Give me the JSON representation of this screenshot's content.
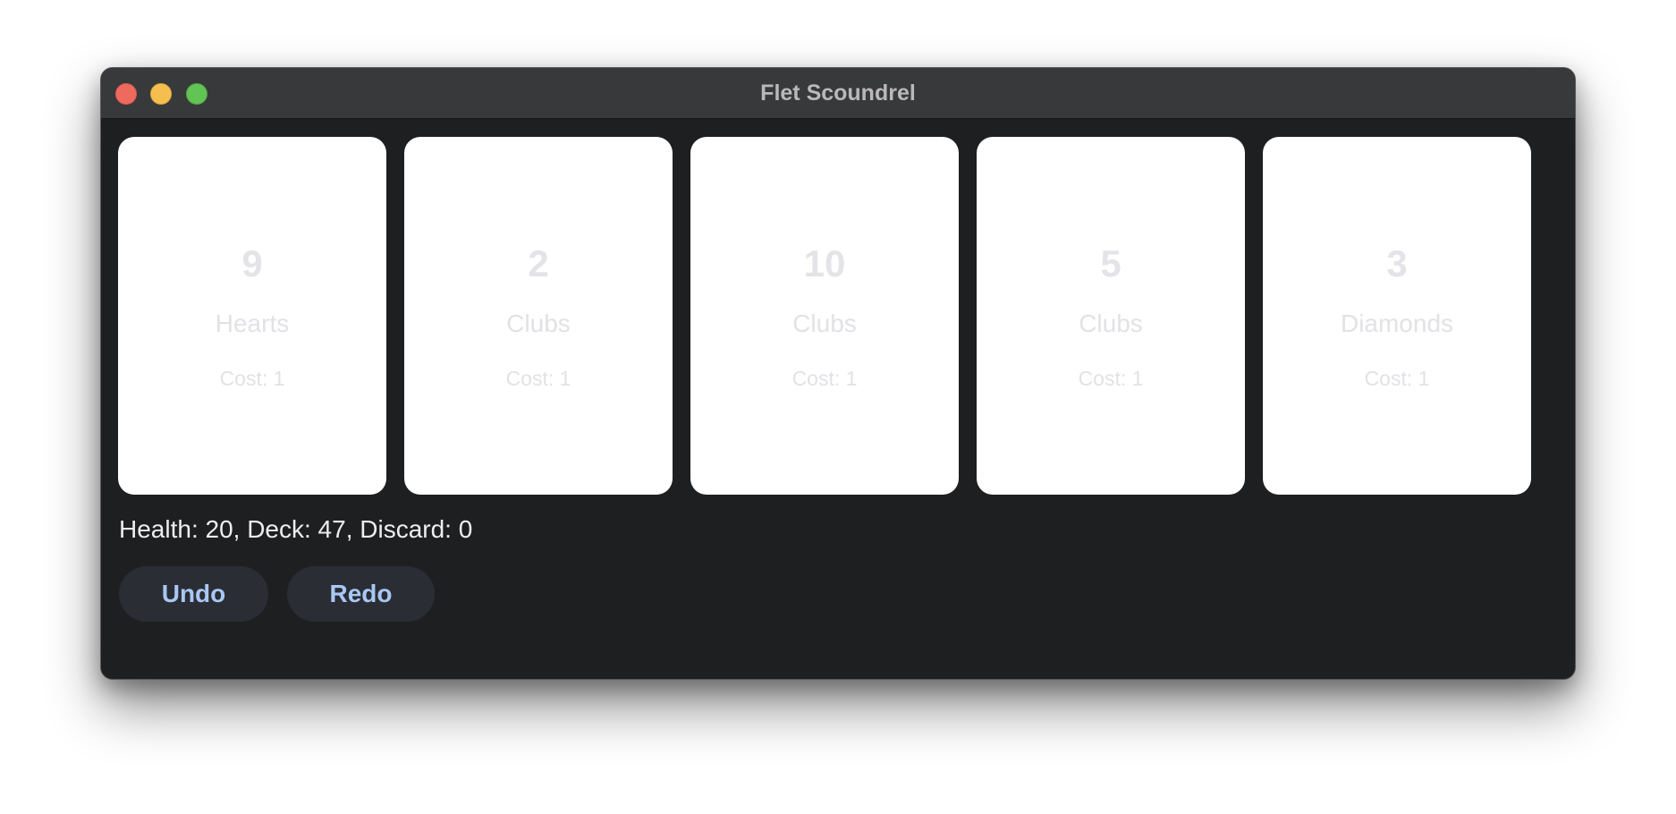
{
  "window": {
    "title": "Flet Scoundrel"
  },
  "cards": [
    {
      "rank": "9",
      "suit": "Hearts",
      "cost": "Cost: 1"
    },
    {
      "rank": "2",
      "suit": "Clubs",
      "cost": "Cost: 1"
    },
    {
      "rank": "10",
      "suit": "Clubs",
      "cost": "Cost: 1"
    },
    {
      "rank": "5",
      "suit": "Clubs",
      "cost": "Cost: 1"
    },
    {
      "rank": "3",
      "suit": "Diamonds",
      "cost": "Cost: 1"
    }
  ],
  "status": {
    "text": "Health: 20, Deck: 47, Discard: 0"
  },
  "buttons": {
    "undo_label": "Undo",
    "redo_label": "Redo"
  },
  "colors": {
    "window_bg": "#1e1f21",
    "titlebar_bg": "#38393b",
    "card_bg": "#ffffff",
    "button_bg": "#2a2d33",
    "button_text": "#a9c7f5",
    "close": "#ee6a5e",
    "minimize": "#f5bf4f",
    "maximize": "#61c454"
  }
}
